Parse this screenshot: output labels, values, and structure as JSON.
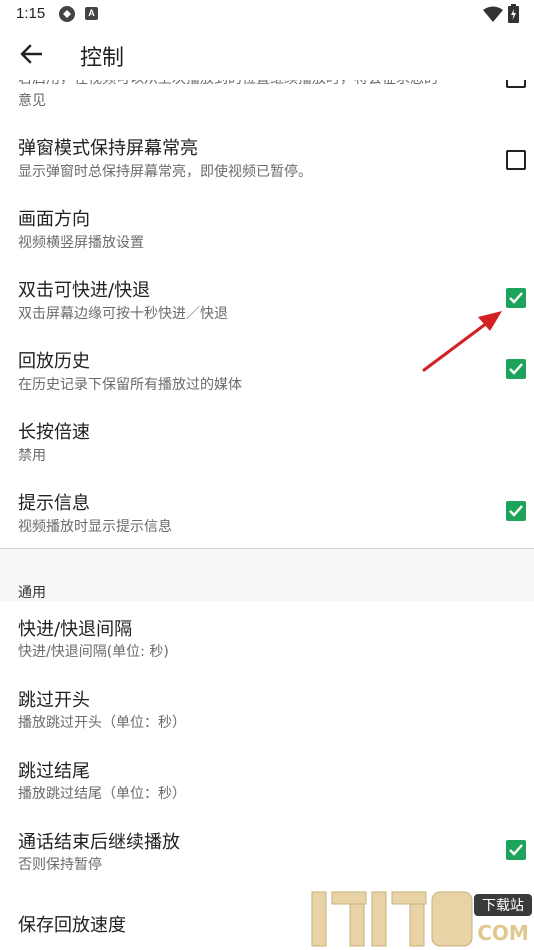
{
  "status_bar": {
    "time": "1:15",
    "icon_a": "A"
  },
  "app_bar": {
    "title": "控制"
  },
  "partial_item": {
    "line1": "若启用，在视频可以从上次播放到的位置继续播放时，将会征求您的",
    "line2": "意见",
    "checked": false
  },
  "items": [
    {
      "title": "弹窗模式保持屏幕常亮",
      "summary": "显示弹窗时总保持屏幕常亮，即使视频已暂停。",
      "checkbox": true,
      "checked": false
    },
    {
      "title": "画面方向",
      "summary": "视频横竖屏播放设置",
      "checkbox": false
    },
    {
      "title": "双击可快进/快退",
      "summary": "双击屏幕边缘可按十秒快进／快退",
      "checkbox": true,
      "checked": true
    },
    {
      "title": "回放历史",
      "summary": "在历史记录下保留所有播放过的媒体",
      "checkbox": true,
      "checked": true
    },
    {
      "title": "长按倍速",
      "summary": "禁用",
      "checkbox": false
    },
    {
      "title": "提示信息",
      "summary": "视频播放时显示提示信息",
      "checkbox": true,
      "checked": true
    }
  ],
  "section": {
    "header": "通用"
  },
  "general_items": [
    {
      "title": "快进/快退间隔",
      "summary": "快进/快退间隔(单位: 秒)",
      "checkbox": false
    },
    {
      "title": "跳过开头",
      "summary": "播放跳过开头（单位：秒）",
      "checkbox": false
    },
    {
      "title": "跳过结尾",
      "summary": "播放跳过结尾（单位：秒）",
      "checkbox": false
    },
    {
      "title": "通话结束后继续播放",
      "summary": "否则保持暂停",
      "checkbox": true,
      "checked": true
    },
    {
      "title": "保存回放速度",
      "summary": "",
      "checkbox": false
    }
  ],
  "watermark": {
    "digits": "17178",
    "tag": "下载站",
    "suffix": "COM"
  },
  "colors": {
    "accent": "#1ea35a",
    "arrow": "#d42020"
  }
}
